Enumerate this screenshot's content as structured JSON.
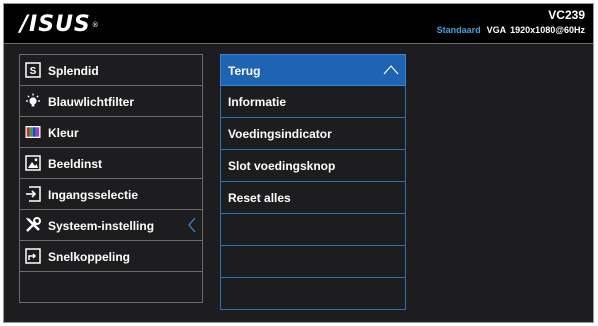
{
  "header": {
    "brand": "/ISUS",
    "brand_mark": "®",
    "model": "VC239",
    "mode": "Standaard",
    "signal": "VGA",
    "resolution": "1920x1080@60Hz"
  },
  "main_menu": {
    "items": [
      {
        "label": "Splendid",
        "icon": "splendid-s-icon"
      },
      {
        "label": "Blauwlichtfilter",
        "icon": "bulb-icon"
      },
      {
        "label": "Kleur",
        "icon": "color-bars-icon"
      },
      {
        "label": "Beeldinst",
        "icon": "picture-icon"
      },
      {
        "label": "Ingangsselectie",
        "icon": "input-arrow-icon"
      },
      {
        "label": "Systeem-instelling",
        "icon": "tools-icon",
        "active": true
      },
      {
        "label": "Snelkoppeling",
        "icon": "shortcut-icon"
      },
      {
        "label": ""
      }
    ]
  },
  "sub_menu": {
    "items": [
      {
        "label": "Terug",
        "selected": true
      },
      {
        "label": "Informatie"
      },
      {
        "label": "Voedingsindicator"
      },
      {
        "label": "Slot voedingsknop"
      },
      {
        "label": "Reset alles"
      },
      {
        "label": ""
      },
      {
        "label": ""
      },
      {
        "label": ""
      }
    ]
  },
  "colors": {
    "accent": "#1e63b4",
    "mode_text": "#3aa0e0",
    "background": "#1d1d1f"
  }
}
